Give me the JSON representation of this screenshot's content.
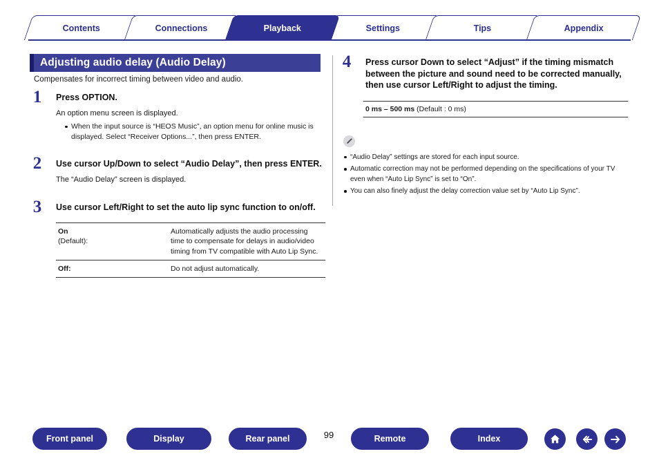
{
  "tabs": [
    {
      "label": "Contents",
      "active": false
    },
    {
      "label": "Connections",
      "active": false
    },
    {
      "label": "Playback",
      "active": true
    },
    {
      "label": "Settings",
      "active": false
    },
    {
      "label": "Tips",
      "active": false
    },
    {
      "label": "Appendix",
      "active": false
    }
  ],
  "page": {
    "title": "Adjusting audio delay (Audio Delay)",
    "intro": "Compensates for incorrect timing between video and audio.",
    "number": "99"
  },
  "steps": [
    {
      "num": "1",
      "head": "Press OPTION.",
      "sub": "An option menu screen is displayed.",
      "bullets": [
        "When the input source is “HEOS Music”, an option menu for online music is displayed. Select “Receiver Options...”, then press ENTER."
      ]
    },
    {
      "num": "2",
      "head": "Use cursor Up/Down to select “Audio Delay”, then press ENTER.",
      "sub": "The “Audio Delay” screen is displayed.",
      "bullets": []
    },
    {
      "num": "3",
      "head": "Use cursor Left/Right to set the auto lip sync function to on/off.",
      "sub": "",
      "bullets": []
    },
    {
      "num": "4",
      "head": "Press cursor Down to select “Adjust” if the timing mismatch between the picture and sound need to be corrected manually, then use cursor Left/Right to adjust the timing.",
      "sub": "",
      "bullets": []
    }
  ],
  "option_table": {
    "rows": [
      {
        "key": "On",
        "key_sub": "(Default)",
        "key_suffix": ":",
        "value": "Automatically adjusts the audio processing time to compensate for delays in audio/video timing from TV compatible with Auto Lip Sync."
      },
      {
        "key": "Off",
        "key_sub": "",
        "key_suffix": ":",
        "value": "Do not adjust automatically."
      }
    ]
  },
  "range_table": {
    "range": "0 ms – 500 ms",
    "default": "(Default : 0 ms)"
  },
  "notes": [
    "“Audio Delay” settings are stored for each input source.",
    "Automatic correction may not be performed depending on the specifications of your TV even when “Auto Lip Sync” is set to “On”.",
    "You can also finely adjust the delay correction value set by “Auto Lip Sync”."
  ],
  "note_icon_name": "pencil-note-icon",
  "footer": {
    "buttons": [
      {
        "label": "Front panel"
      },
      {
        "label": "Display"
      },
      {
        "label": "Rear panel"
      },
      {
        "label": "Remote"
      },
      {
        "label": "Index"
      }
    ],
    "icons": [
      {
        "name": "home-icon"
      },
      {
        "name": "arrow-left-icon"
      },
      {
        "name": "arrow-right-icon"
      }
    ]
  },
  "colors": {
    "brand": "#2e3192",
    "title_bar": "#3b3f96",
    "title_bar_accent": "#1b1e6b"
  }
}
